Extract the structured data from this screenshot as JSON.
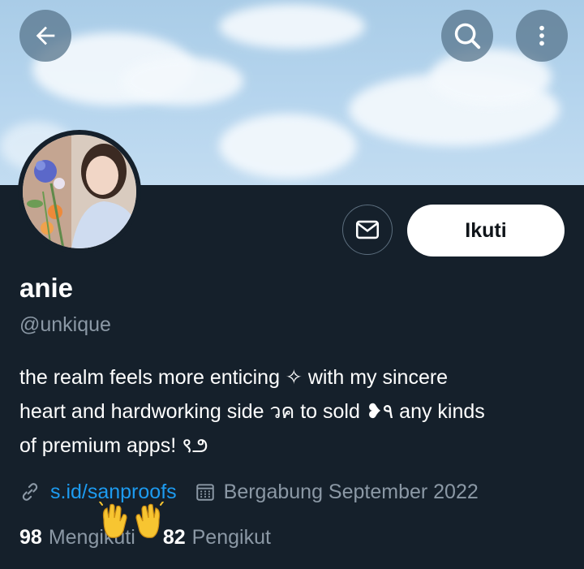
{
  "header": {
    "back_icon": "arrow-left-icon",
    "search_icon": "search-icon",
    "more_icon": "more-vertical-icon"
  },
  "profile": {
    "display_name": "anie",
    "handle": "@unkique",
    "bio_lines": [
      "the realm feels more enticing ✧ with my sincere",
      "heart and hardworking side วค to sold ❥٩ any kinds",
      "of premium apps! ९౨"
    ],
    "website": "s.id/sanproofs",
    "joined": "Bergabung September 2022"
  },
  "actions": {
    "message_icon": "mail-icon",
    "follow_label": "Ikuti"
  },
  "stats": {
    "following_count": "98",
    "following_label": "Mengikuti",
    "followers_count": "82",
    "followers_label": "Pengikut"
  },
  "colors": {
    "background": "#15202b",
    "accent": "#1d9bf0",
    "muted": "#8b98a5",
    "banner_sky": "#b6d5ee"
  }
}
